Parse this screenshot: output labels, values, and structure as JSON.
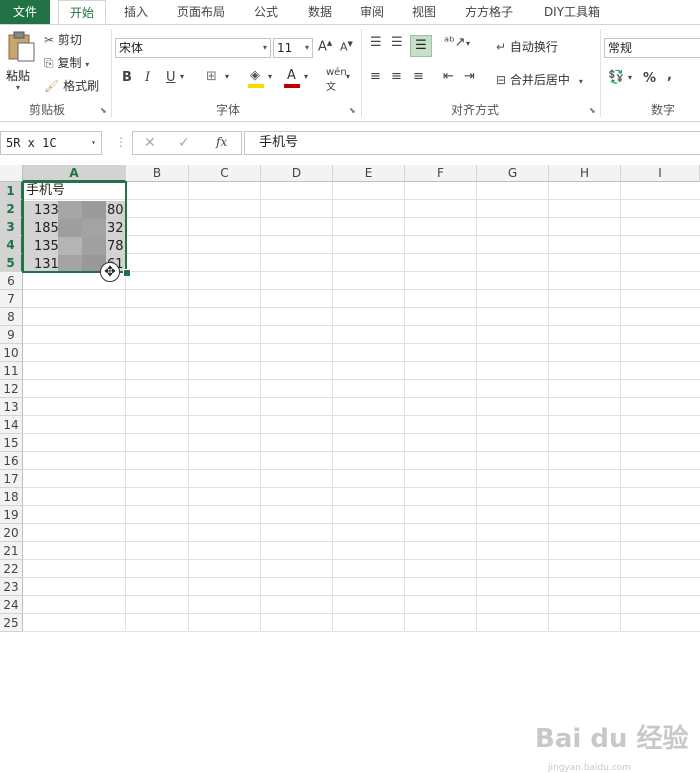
{
  "tabs": [
    "文件",
    "开始",
    "插入",
    "页面布局",
    "公式",
    "数据",
    "审阅",
    "视图",
    "方方格子",
    "DIY工具箱"
  ],
  "clipboard": {
    "paste": "粘贴",
    "cut": "剪切",
    "copy": "复制",
    "format_painter": "格式刷",
    "label": "剪贴板"
  },
  "font": {
    "name": "宋体",
    "size": "11",
    "bold": "B",
    "italic": "I",
    "underline": "U",
    "label": "字体"
  },
  "alignment": {
    "wrap_text": "自动换行",
    "merge_center": "合并后居中",
    "label": "对齐方式"
  },
  "number": {
    "format": "常规",
    "percent": "%",
    "comma": ",",
    "label": "数字"
  },
  "formula_bar": {
    "name_box": "5R x 1C",
    "fx": "fx",
    "content": "手机号"
  },
  "columns": [
    "A",
    "B",
    "C",
    "D",
    "E",
    "F",
    "G",
    "H",
    "I"
  ],
  "rows": [
    "1",
    "2",
    "3",
    "4",
    "5",
    "6",
    "7",
    "8",
    "9",
    "10",
    "11",
    "12",
    "13",
    "14",
    "15",
    "16",
    "17",
    "18",
    "19",
    "20",
    "21",
    "22",
    "23",
    "24",
    "25"
  ],
  "cells": {
    "A1": "手机号",
    "A2_left": "133",
    "A2_right": "80",
    "A3_left": "185",
    "A3_right": "32",
    "A4_left": "135",
    "A4_right": "78",
    "A5_left": "131",
    "A5_right": "61"
  },
  "watermark": {
    "brand": "Bai du 经验",
    "url": "jingyan.baidu.com"
  },
  "colors": {
    "accent": "#217346"
  }
}
